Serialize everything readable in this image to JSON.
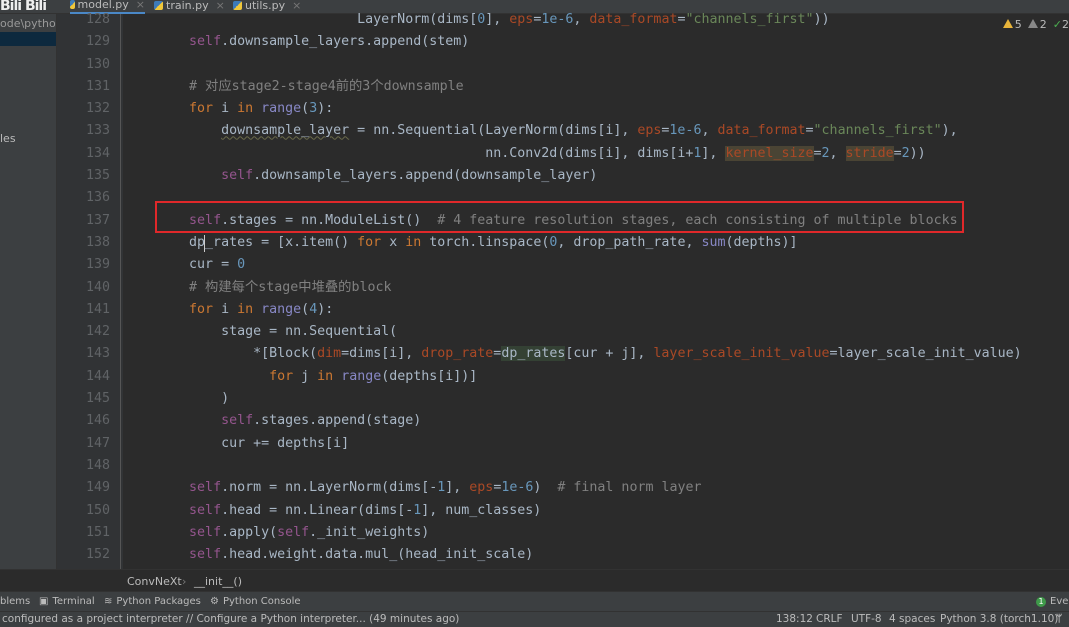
{
  "tabs": [
    {
      "label": "model.py",
      "active": true
    },
    {
      "label": "train.py"
    },
    {
      "label": "utils.py"
    }
  ],
  "project_path": "ode\\pythonP",
  "project_item": "les",
  "inspections": {
    "warnings": "5",
    "weak_warnings": "2",
    "ok": "2"
  },
  "cursor_position": "138:12",
  "code_lines": [
    {
      "n": "128",
      "s": [
        [
          "                             LayerNorm(dims[",
          ""
        ],
        [
          "0",
          "num"
        ],
        [
          "], ",
          ""
        ],
        [
          "eps",
          "kwa"
        ],
        [
          "=",
          ""
        ],
        [
          "1e-6",
          "num"
        ],
        [
          ", ",
          ""
        ],
        [
          "data_format",
          "kwa"
        ],
        [
          "=",
          ""
        ],
        [
          "\"channels_first\"",
          "str"
        ],
        [
          "))",
          ""
        ]
      ]
    },
    {
      "n": "129",
      "s": [
        [
          "        ",
          ""
        ],
        [
          "self",
          "self"
        ],
        [
          ".downsample_layers.append(stem)",
          ""
        ]
      ]
    },
    {
      "n": "130",
      "s": []
    },
    {
      "n": "131",
      "s": [
        [
          "        # 对应stage2-stage4前的3个downsample",
          "cm"
        ]
      ]
    },
    {
      "n": "132",
      "s": [
        [
          "        ",
          ""
        ],
        [
          "for",
          "kw"
        ],
        [
          " i ",
          ""
        ],
        [
          "in",
          "kw"
        ],
        [
          " ",
          ""
        ],
        [
          "range",
          "bi"
        ],
        [
          "(",
          ""
        ],
        [
          "3",
          "num"
        ],
        [
          "):",
          ""
        ]
      ]
    },
    {
      "n": "133",
      "s": [
        [
          "            ",
          ""
        ],
        [
          "downsample_layer",
          "wavy"
        ],
        [
          " = nn.Sequential(LayerNorm(dims[i], ",
          ""
        ],
        [
          "eps",
          "kwa"
        ],
        [
          "=",
          ""
        ],
        [
          "1e-6",
          "num"
        ],
        [
          ", ",
          ""
        ],
        [
          "data_format",
          "kwa"
        ],
        [
          "=",
          ""
        ],
        [
          "\"channels_first\"",
          "str"
        ],
        [
          "),",
          ""
        ]
      ]
    },
    {
      "n": "134",
      "s": [
        [
          "                                             nn.Conv2d(dims[i], dims[i+",
          ""
        ],
        [
          "1",
          "num"
        ],
        [
          "], ",
          ""
        ],
        [
          "kernel_size",
          "kwa hlb"
        ],
        [
          "=",
          ""
        ],
        [
          "2",
          "num"
        ],
        [
          ", ",
          ""
        ],
        [
          "stride",
          "kwa hlb"
        ],
        [
          "=",
          ""
        ],
        [
          "2",
          "num"
        ],
        [
          "))",
          ""
        ]
      ]
    },
    {
      "n": "135",
      "s": [
        [
          "            ",
          ""
        ],
        [
          "self",
          "self"
        ],
        [
          ".downsample_layers.append(downsample_layer)",
          ""
        ]
      ]
    },
    {
      "n": "136",
      "s": []
    },
    {
      "n": "137",
      "s": [
        [
          "        ",
          ""
        ],
        [
          "self",
          "self"
        ],
        [
          ".stages = nn.ModuleList()  ",
          ""
        ],
        [
          "# 4 feature resolution stages, each consisting of multiple blocks",
          "cm"
        ]
      ]
    },
    {
      "n": "138",
      "s": [
        [
          "        dp_rates = [x.item() ",
          ""
        ],
        [
          "for",
          "kw"
        ],
        [
          " x ",
          ""
        ],
        [
          "in",
          "kw"
        ],
        [
          " torch.linspace(",
          ""
        ],
        [
          "0",
          "num"
        ],
        [
          ", drop_path_rate, ",
          ""
        ],
        [
          "sum",
          "bi"
        ],
        [
          "(depths)]",
          ""
        ]
      ]
    },
    {
      "n": "139",
      "s": [
        [
          "        cur = ",
          ""
        ],
        [
          "0",
          "num"
        ]
      ]
    },
    {
      "n": "140",
      "s": [
        [
          "        # 构建每个stage中堆叠的block",
          "cm"
        ]
      ]
    },
    {
      "n": "141",
      "s": [
        [
          "        ",
          ""
        ],
        [
          "for",
          "kw"
        ],
        [
          " i ",
          ""
        ],
        [
          "in",
          "kw"
        ],
        [
          " ",
          ""
        ],
        [
          "range",
          "bi"
        ],
        [
          "(",
          ""
        ],
        [
          "4",
          "num"
        ],
        [
          "):",
          ""
        ]
      ]
    },
    {
      "n": "142",
      "s": [
        [
          "            stage = nn.Sequential(",
          ""
        ]
      ]
    },
    {
      "n": "143",
      "s": [
        [
          "                *[Block(",
          ""
        ],
        [
          "dim",
          "kwa"
        ],
        [
          "=dims[i], ",
          ""
        ],
        [
          "drop_rate",
          "kwa"
        ],
        [
          "=",
          ""
        ],
        [
          "dp_rates",
          "hlg"
        ],
        [
          "[cur + j], ",
          ""
        ],
        [
          "layer_scale_init_value",
          "kwa"
        ],
        [
          "=layer_scale_init_value)",
          ""
        ]
      ]
    },
    {
      "n": "144",
      "s": [
        [
          "                  ",
          ""
        ],
        [
          "for",
          "kw"
        ],
        [
          " j ",
          ""
        ],
        [
          "in",
          "kw"
        ],
        [
          " ",
          ""
        ],
        [
          "range",
          "bi"
        ],
        [
          "(depths[i])]",
          ""
        ]
      ]
    },
    {
      "n": "145",
      "s": [
        [
          "            )",
          ""
        ]
      ]
    },
    {
      "n": "146",
      "s": [
        [
          "            ",
          ""
        ],
        [
          "self",
          "self"
        ],
        [
          ".stages.append(stage)",
          ""
        ]
      ]
    },
    {
      "n": "147",
      "s": [
        [
          "            cur += depths[i]",
          ""
        ]
      ]
    },
    {
      "n": "148",
      "s": []
    },
    {
      "n": "149",
      "s": [
        [
          "        ",
          ""
        ],
        [
          "self",
          "self"
        ],
        [
          ".norm = nn.LayerNorm(dims[-",
          ""
        ],
        [
          "1",
          "num"
        ],
        [
          "], ",
          ""
        ],
        [
          "eps",
          "kwa"
        ],
        [
          "=",
          ""
        ],
        [
          "1e-6",
          "num"
        ],
        [
          ")  ",
          ""
        ],
        [
          "# final norm layer",
          "cm"
        ]
      ]
    },
    {
      "n": "150",
      "s": [
        [
          "        ",
          ""
        ],
        [
          "self",
          "self"
        ],
        [
          ".head = nn.Linear(dims[-",
          ""
        ],
        [
          "1",
          "num"
        ],
        [
          "], num_classes)",
          ""
        ]
      ]
    },
    {
      "n": "151",
      "s": [
        [
          "        ",
          ""
        ],
        [
          "self",
          "self"
        ],
        [
          ".apply(",
          ""
        ],
        [
          "self",
          "self"
        ],
        [
          "._init_weights)",
          ""
        ]
      ]
    },
    {
      "n": "152",
      "s": [
        [
          "        ",
          ""
        ],
        [
          "self",
          "self"
        ],
        [
          ".head.weight.data.mul_(head_init_scale)",
          ""
        ]
      ]
    }
  ],
  "breadcrumb": {
    "class": "ConvNeXt",
    "separator": "›",
    "method": "__init__()"
  },
  "tool_windows": {
    "problems": "blems",
    "terminal": "Terminal",
    "packages": "Python Packages",
    "console": "Python Console",
    "events_count": "1",
    "events": "Even"
  },
  "status": {
    "message": "configured as a project interpreter // Configure a Python interpreter... (49 minutes ago)",
    "position": "138:12",
    "line_sep": "CRLF",
    "encoding": "UTF-8",
    "indent": "4 spaces",
    "interpreter": "Python 3.8 (torch1.10)"
  }
}
